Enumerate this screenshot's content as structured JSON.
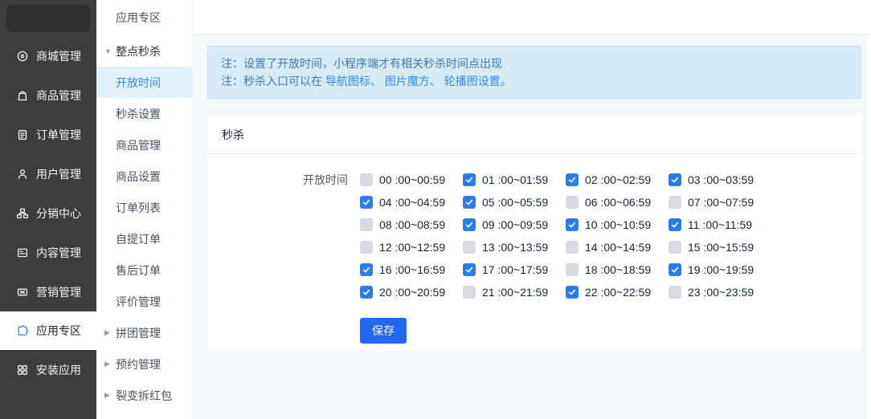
{
  "colors": {
    "accent": "#2d8cf0",
    "checkbox_checked": "#2b7cf0",
    "save_button": "#2468f2",
    "notice_bg": "#d7ebf7",
    "notice_text": "#3c7bb5",
    "sidebar_bg": "#3d3d3d",
    "submenu_selected_bg": "#e3f1fb"
  },
  "sidebar": {
    "items": [
      {
        "label": "商城管理",
        "icon": "mall-icon",
        "active": false
      },
      {
        "label": "商品管理",
        "icon": "goods-icon",
        "active": false
      },
      {
        "label": "订单管理",
        "icon": "orders-icon",
        "active": false
      },
      {
        "label": "用户管理",
        "icon": "users-icon",
        "active": false
      },
      {
        "label": "分销中心",
        "icon": "distribution-icon",
        "active": false
      },
      {
        "label": "内容管理",
        "icon": "content-icon",
        "active": false
      },
      {
        "label": "营销管理",
        "icon": "marketing-icon",
        "active": false
      },
      {
        "label": "应用专区",
        "icon": "apps-icon",
        "active": true
      },
      {
        "label": "安装应用",
        "icon": "install-icon",
        "active": false
      }
    ]
  },
  "submenu": {
    "items": [
      {
        "label": "应用专区",
        "type": "top"
      },
      {
        "label": "整点秒杀",
        "type": "expanded"
      },
      {
        "label": "开放时间",
        "type": "sub",
        "selected": true
      },
      {
        "label": "秒杀设置",
        "type": "sub",
        "selected": false
      },
      {
        "label": "商品管理",
        "type": "sub",
        "selected": false
      },
      {
        "label": "商品设置",
        "type": "sub",
        "selected": false
      },
      {
        "label": "订单列表",
        "type": "sub",
        "selected": false
      },
      {
        "label": "自提订单",
        "type": "sub",
        "selected": false
      },
      {
        "label": "售后订单",
        "type": "sub",
        "selected": false
      },
      {
        "label": "评价管理",
        "type": "sub",
        "selected": false
      },
      {
        "label": "拼团管理",
        "type": "collapsed"
      },
      {
        "label": "预约管理",
        "type": "collapsed"
      },
      {
        "label": "裂变拆红包",
        "type": "collapsed"
      }
    ]
  },
  "notice": {
    "line1": "注：设置了开放时间，小程序端才有相关秒杀时间点出现",
    "line2_prefix": "注：秒杀入口可以在 ",
    "line2_highlight": "导航图标、 图片魔方、 轮播图设置。"
  },
  "panel": {
    "title": "秒杀",
    "open_time_label": "开放时间",
    "save_label": "保存"
  },
  "time_slots": [
    {
      "label": "00 :00~00:59",
      "checked": false
    },
    {
      "label": "01 :00~01:59",
      "checked": true
    },
    {
      "label": "02 :00~02:59",
      "checked": true
    },
    {
      "label": "03 :00~03:59",
      "checked": true
    },
    {
      "label": "04 :00~04:59",
      "checked": true
    },
    {
      "label": "05 :00~05:59",
      "checked": true
    },
    {
      "label": "06 :00~06:59",
      "checked": false
    },
    {
      "label": "07 :00~07:59",
      "checked": false
    },
    {
      "label": "08 :00~08:59",
      "checked": false
    },
    {
      "label": "09 :00~09:59",
      "checked": true
    },
    {
      "label": "10 :00~10:59",
      "checked": true
    },
    {
      "label": "11 :00~11:59",
      "checked": true
    },
    {
      "label": "12 :00~12:59",
      "checked": false
    },
    {
      "label": "13 :00~13:59",
      "checked": false
    },
    {
      "label": "14 :00~14:59",
      "checked": false
    },
    {
      "label": "15 :00~15:59",
      "checked": false
    },
    {
      "label": "16 :00~16:59",
      "checked": true
    },
    {
      "label": "17 :00~17:59",
      "checked": true
    },
    {
      "label": "18 :00~18:59",
      "checked": false
    },
    {
      "label": "19 :00~19:59",
      "checked": true
    },
    {
      "label": "20 :00~20:59",
      "checked": true
    },
    {
      "label": "21 :00~21:59",
      "checked": false
    },
    {
      "label": "22 :00~22:59",
      "checked": true
    },
    {
      "label": "23 :00~23:59",
      "checked": false
    }
  ]
}
